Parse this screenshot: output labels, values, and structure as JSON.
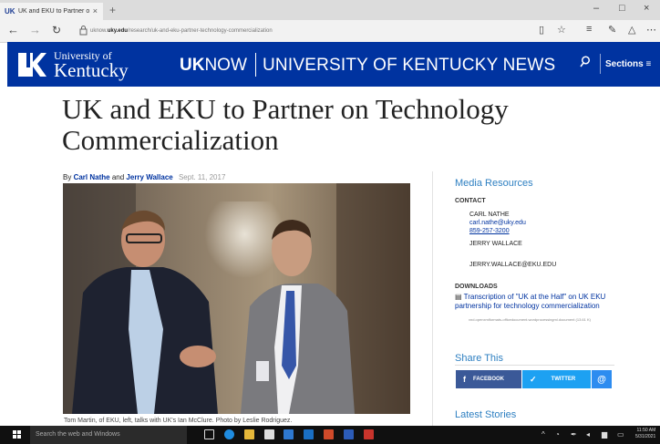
{
  "browser": {
    "tab_title": "UK and EKU to Partner o",
    "tab_close": "×",
    "new_tab": "+",
    "url_prefix": "uknow.",
    "url_domain": "uky.edu",
    "url_path": "/research/uk-and-eku-partner-technology-commercialization",
    "win_minimize": "–",
    "win_maximize": "□",
    "win_close": "×"
  },
  "site": {
    "logo_line1": "University of",
    "logo_line2": "Kentucky",
    "uknow_bold": "UK",
    "uknow_rest": "NOW",
    "news_title": "UNIVERSITY OF KENTUCKY NEWS",
    "sections_label": "Sections ≡"
  },
  "article": {
    "headline": "UK and EKU to Partner on Technology Commercialization",
    "by": "By",
    "author1": "Carl Nathe",
    "and": "and",
    "author2": "Jerry Wallace",
    "date": "Sept. 11, 2017",
    "caption": "Tom Martin, of EKU, left, talks with UK's Ian McClure. Photo by Leslie Rodriguez."
  },
  "sidebar": {
    "media_title": "Media Resources",
    "contact_heading": "CONTACT",
    "contact1_name": "CARL NATHE",
    "contact1_email": "carl.nathe@uky.edu",
    "contact1_phone": "859-257-3200",
    "contact2_name": "JERRY WALLACE",
    "contact2_email": "JERRY.WALLACE@EKU.EDU",
    "downloads_heading": "DOWNLOADS",
    "download_title": "Transcription of \"UK at the Half\" on UK EKU partnership for technology commercialization",
    "download_meta": "vnd.openxmlformats-officedocument.wordprocessingml.document (13.61 K)",
    "share_title": "Share This",
    "facebook": "FACEBOOK",
    "twitter": "TWITTER",
    "latest_title": "Latest Stories"
  },
  "taskbar": {
    "search_placeholder": "Search the web and Windows",
    "time": "11:50 AM",
    "date": "5/31/2021"
  },
  "colors": {
    "uk_blue": "#0033a0",
    "link_blue": "#2d7fc1",
    "facebook": "#3b5998",
    "twitter": "#1da1f2"
  }
}
